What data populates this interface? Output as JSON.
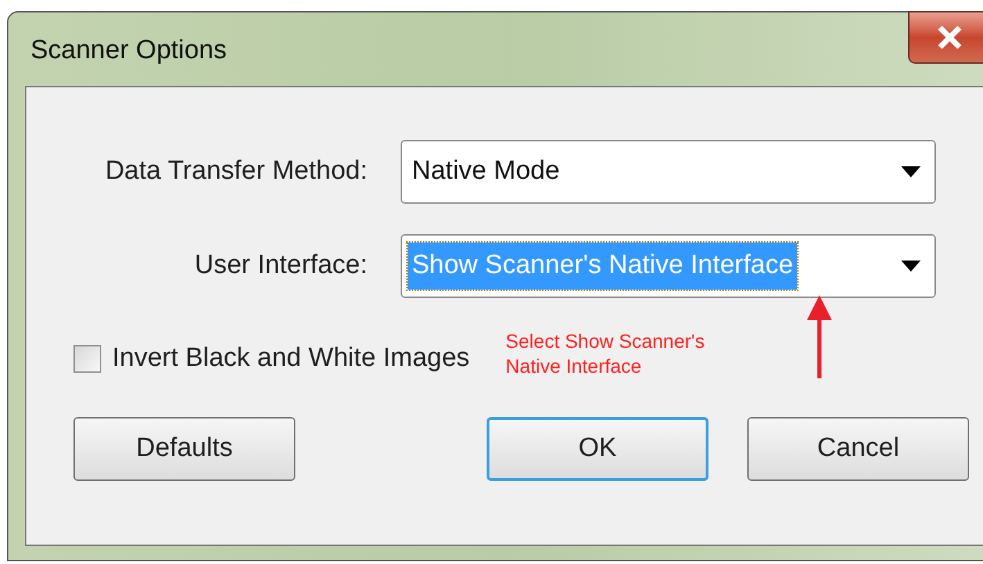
{
  "window": {
    "title": "Scanner Options"
  },
  "fields": [
    {
      "label": "Data Transfer Method:",
      "value": "Native Mode",
      "selected": false
    },
    {
      "label": "User Interface:",
      "value": "Show Scanner's Native Interface",
      "selected": true
    }
  ],
  "checkbox": {
    "label": "Invert Black and White Images",
    "checked": false
  },
  "annotation": {
    "lines": [
      "Select Show Scanner's",
      "Native Interface"
    ]
  },
  "buttons": [
    {
      "label": "Defaults",
      "default": false
    },
    {
      "label": "OK",
      "default": true
    },
    {
      "label": "Cancel",
      "default": false
    }
  ]
}
